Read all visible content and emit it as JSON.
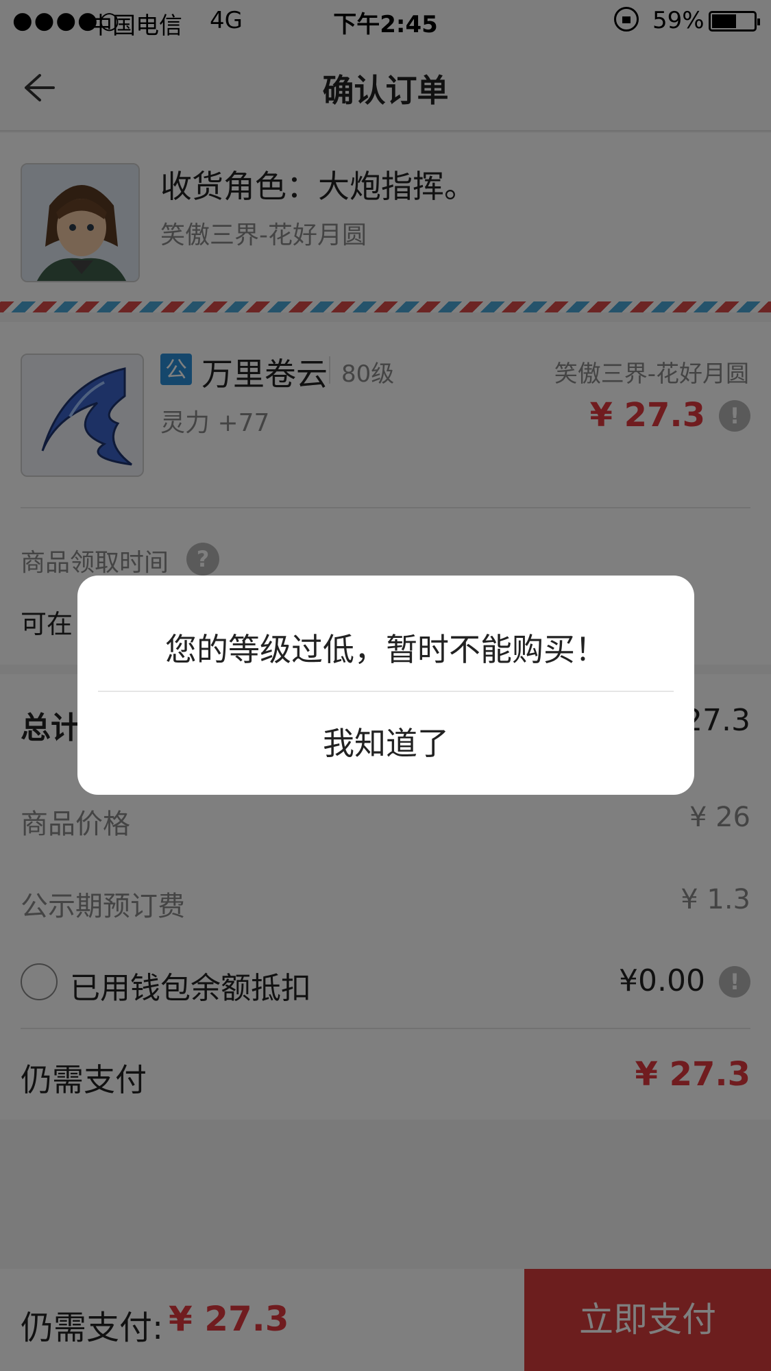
{
  "status_bar": {
    "signal": "●●●●○",
    "carrier": "中国电信",
    "network": "4G",
    "time": "下午2:45",
    "battery": "59%",
    "battery_level": 0.59
  },
  "nav": {
    "back_icon": "arrow-left-icon",
    "title": "确认订单"
  },
  "receiver": {
    "name_label": "收货角色：大炮指挥。",
    "server": "笑傲三界-花好月圆"
  },
  "item": {
    "badge": "公",
    "name": "万里卷云",
    "level": "80级",
    "server": "笑傲三界-花好月圆",
    "attr": "灵力 +77",
    "price": "¥ 27.3",
    "pickup_label": "商品领取时间",
    "pickup_desc": "可在"
  },
  "summary": {
    "total_label": "总计",
    "total_value": "27.3",
    "goods_label": "商品价格",
    "goods_value": "¥ 26",
    "fee_label": "公示期预订费",
    "fee_value": "¥ 1.3",
    "wallet_label": "已用钱包余额抵扣",
    "wallet_value": "¥0.00",
    "remain_label": "仍需支付",
    "remain_value": "¥ 27.3"
  },
  "bottom_bar": {
    "label": "仍需支付:",
    "price": "¥ 27.3",
    "pay_button": "立即支付"
  },
  "dialog": {
    "message": "您的等级过低，暂时不能购买！",
    "confirm": "我知道了"
  },
  "colors": {
    "accent_red": "#e0383e",
    "pay_button": "#d83c3c",
    "badge_blue": "#2a8fd8"
  }
}
